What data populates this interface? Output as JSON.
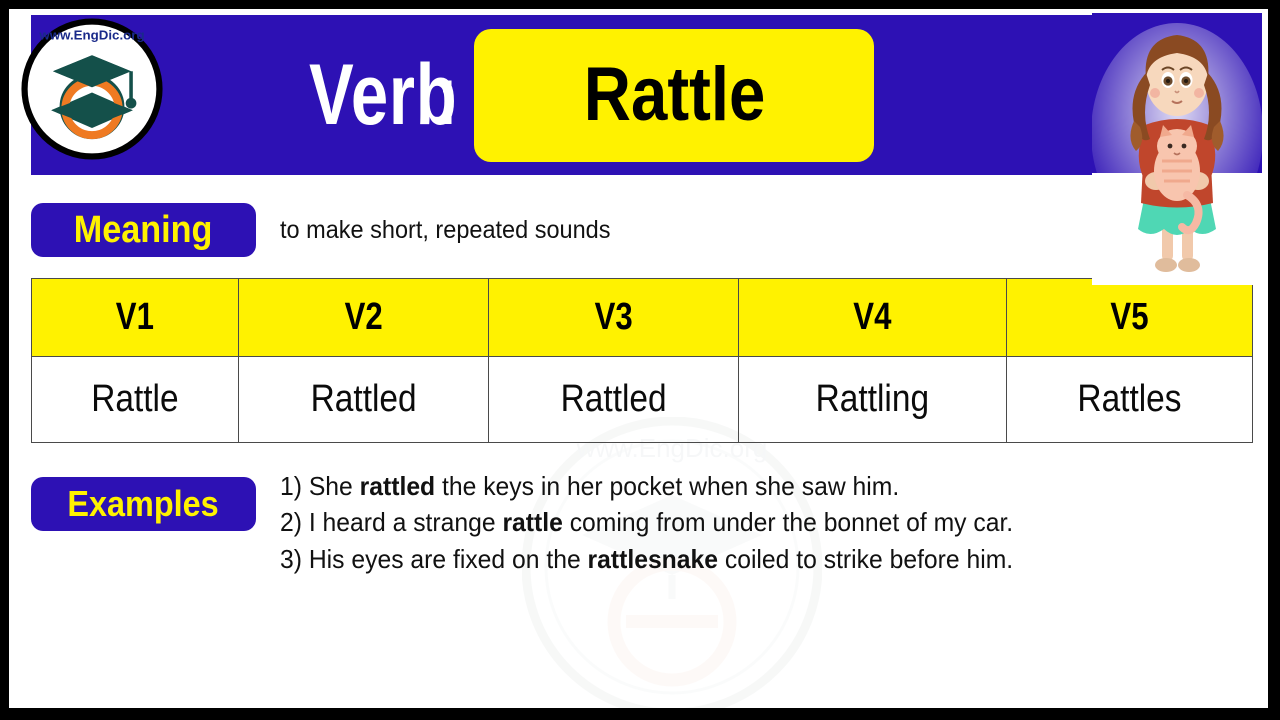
{
  "colors": {
    "brand_blue": "#2d11b4",
    "accent_yellow": "#fff200",
    "frame_black": "#000000",
    "text_black": "#111111"
  },
  "logo": {
    "name": "engdic-logo",
    "text_top": "www.",
    "text_mid": "EngDic",
    "text_end": ".org",
    "letter": "e"
  },
  "header": {
    "part_of_speech_label": "Verb",
    "separator": ":",
    "word": "Rattle"
  },
  "illustration": {
    "name": "girl-holding-cat",
    "description": "girl with curly brown hair holding a striped cat",
    "shirt_color": "#c0462c",
    "skirt_color": "#4fd7b4",
    "hair_color": "#8a4a22",
    "cat_color": "#f6b9a4"
  },
  "meaning": {
    "label": "Meaning",
    "text": "to make short, repeated sounds"
  },
  "verb_table": {
    "headers": [
      "V1",
      "V2",
      "V3",
      "V4",
      "V5"
    ],
    "forms": [
      "Rattle",
      "Rattled",
      "Rattled",
      "Rattling",
      "Rattles"
    ]
  },
  "examples": {
    "label": "Examples",
    "items": [
      {
        "number": "1)",
        "before": " She ",
        "bold": "rattled",
        "after": " the keys in her pocket when she saw him."
      },
      {
        "number": "2)",
        "before": " I heard a strange ",
        "bold": "rattle",
        "after": " coming from under the bonnet of my car."
      },
      {
        "number": "3)",
        "before": " His eyes are fixed on the ",
        "bold": "rattlesnake",
        "after": " coiled to strike before him."
      }
    ]
  },
  "watermark": {
    "name": "engdic-watermark",
    "text": "www.EngDic.org"
  }
}
